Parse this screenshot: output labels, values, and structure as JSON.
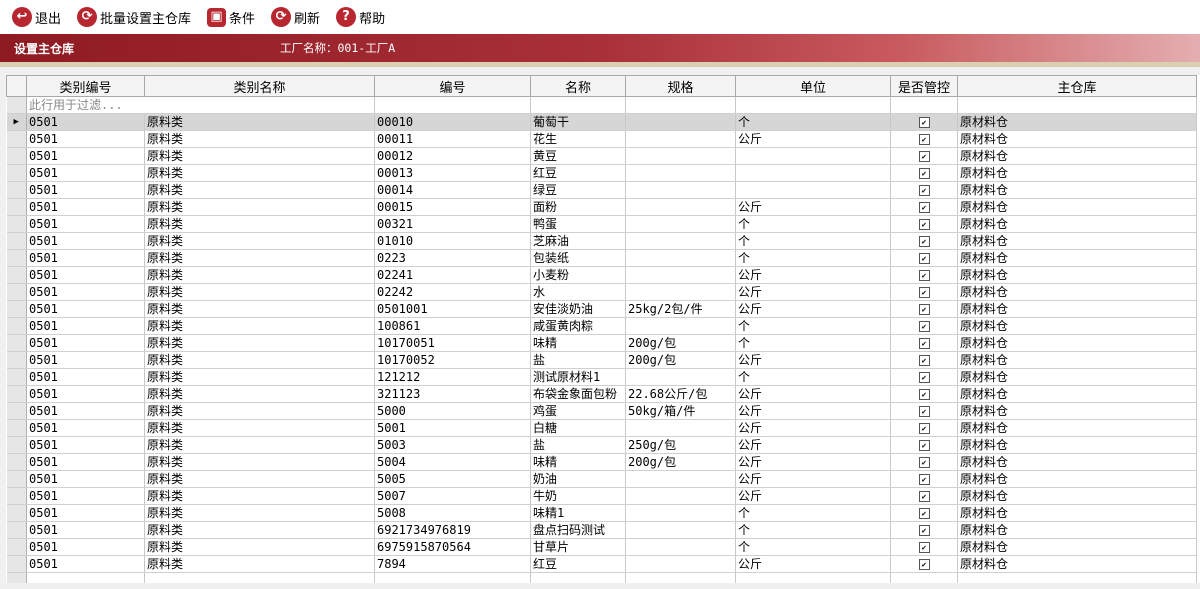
{
  "toolbar": {
    "buttons": [
      {
        "id": "exit",
        "label": "退出",
        "icon": "exit-icon",
        "glyph": "↩"
      },
      {
        "id": "batch",
        "label": "批量设置主仓库",
        "icon": "refresh-icon",
        "glyph": "⟳"
      },
      {
        "id": "condition",
        "label": "条件",
        "icon": "condition-icon",
        "glyph": "▣"
      },
      {
        "id": "refresh",
        "label": "刷新",
        "icon": "refresh-icon",
        "glyph": "⟳"
      },
      {
        "id": "help",
        "label": "帮助",
        "icon": "help-icon",
        "glyph": "?"
      }
    ]
  },
  "titlebar": {
    "title": "设置主仓库",
    "factory": "工厂名称：001-工厂A"
  },
  "colors": {
    "accent": "#b8272f",
    "titlebar": "#8e1a22"
  },
  "table": {
    "columns": [
      "类别编号",
      "类别名称",
      "编号",
      "名称",
      "规格",
      "单位",
      "是否管控",
      "主仓库"
    ],
    "filter_placeholder": "此行用于过滤...",
    "rows": [
      {
        "cat_code": "0501",
        "cat_name": "原料类",
        "code": "00010",
        "name": "葡萄干",
        "spec": "",
        "unit": "个",
        "controlled": true,
        "warehouse": "原材料仓"
      },
      {
        "cat_code": "0501",
        "cat_name": "原料类",
        "code": "00011",
        "name": "花生",
        "spec": "",
        "unit": "公斤",
        "controlled": true,
        "warehouse": "原材料仓"
      },
      {
        "cat_code": "0501",
        "cat_name": "原料类",
        "code": "00012",
        "name": "黄豆",
        "spec": "",
        "unit": "",
        "controlled": true,
        "warehouse": "原材料仓"
      },
      {
        "cat_code": "0501",
        "cat_name": "原料类",
        "code": "00013",
        "name": "红豆",
        "spec": "",
        "unit": "",
        "controlled": true,
        "warehouse": "原材料仓"
      },
      {
        "cat_code": "0501",
        "cat_name": "原料类",
        "code": "00014",
        "name": "绿豆",
        "spec": "",
        "unit": "",
        "controlled": true,
        "warehouse": "原材料仓"
      },
      {
        "cat_code": "0501",
        "cat_name": "原料类",
        "code": "00015",
        "name": "面粉",
        "spec": "",
        "unit": "公斤",
        "controlled": true,
        "warehouse": "原材料仓"
      },
      {
        "cat_code": "0501",
        "cat_name": "原料类",
        "code": "00321",
        "name": "鸭蛋",
        "spec": "",
        "unit": "个",
        "controlled": true,
        "warehouse": "原材料仓"
      },
      {
        "cat_code": "0501",
        "cat_name": "原料类",
        "code": "01010",
        "name": "芝麻油",
        "spec": "",
        "unit": "个",
        "controlled": true,
        "warehouse": "原材料仓"
      },
      {
        "cat_code": "0501",
        "cat_name": "原料类",
        "code": "0223",
        "name": "包装纸",
        "spec": "",
        "unit": "个",
        "controlled": true,
        "warehouse": "原材料仓"
      },
      {
        "cat_code": "0501",
        "cat_name": "原料类",
        "code": "02241",
        "name": "小麦粉",
        "spec": "",
        "unit": "公斤",
        "controlled": true,
        "warehouse": "原材料仓"
      },
      {
        "cat_code": "0501",
        "cat_name": "原料类",
        "code": "02242",
        "name": "水",
        "spec": "",
        "unit": "公斤",
        "controlled": true,
        "warehouse": "原材料仓"
      },
      {
        "cat_code": "0501",
        "cat_name": "原料类",
        "code": "0501001",
        "name": "安佳淡奶油",
        "spec": "25kg/2包/件",
        "unit": "公斤",
        "controlled": true,
        "warehouse": "原材料仓"
      },
      {
        "cat_code": "0501",
        "cat_name": "原料类",
        "code": "100861",
        "name": "咸蛋黄肉粽",
        "spec": "",
        "unit": "个",
        "controlled": true,
        "warehouse": "原材料仓"
      },
      {
        "cat_code": "0501",
        "cat_name": "原料类",
        "code": "10170051",
        "name": "味精",
        "spec": "200g/包",
        "unit": "个",
        "controlled": true,
        "warehouse": "原材料仓"
      },
      {
        "cat_code": "0501",
        "cat_name": "原料类",
        "code": "10170052",
        "name": "盐",
        "spec": "200g/包",
        "unit": "公斤",
        "controlled": true,
        "warehouse": "原材料仓"
      },
      {
        "cat_code": "0501",
        "cat_name": "原料类",
        "code": "121212",
        "name": "测试原材料1",
        "spec": "",
        "unit": "个",
        "controlled": true,
        "warehouse": "原材料仓"
      },
      {
        "cat_code": "0501",
        "cat_name": "原料类",
        "code": "321123",
        "name": "布袋金象面包粉",
        "spec": "22.68公斤/包",
        "unit": "公斤",
        "controlled": true,
        "warehouse": "原材料仓"
      },
      {
        "cat_code": "0501",
        "cat_name": "原料类",
        "code": "5000",
        "name": "鸡蛋",
        "spec": "50kg/箱/件",
        "unit": "公斤",
        "controlled": true,
        "warehouse": "原材料仓"
      },
      {
        "cat_code": "0501",
        "cat_name": "原料类",
        "code": "5001",
        "name": "白糖",
        "spec": "",
        "unit": "公斤",
        "controlled": true,
        "warehouse": "原材料仓"
      },
      {
        "cat_code": "0501",
        "cat_name": "原料类",
        "code": "5003",
        "name": "盐",
        "spec": "250g/包",
        "unit": "公斤",
        "controlled": true,
        "warehouse": "原材料仓"
      },
      {
        "cat_code": "0501",
        "cat_name": "原料类",
        "code": "5004",
        "name": "味精",
        "spec": "200g/包",
        "unit": "公斤",
        "controlled": true,
        "warehouse": "原材料仓"
      },
      {
        "cat_code": "0501",
        "cat_name": "原料类",
        "code": "5005",
        "name": "奶油",
        "spec": "",
        "unit": "公斤",
        "controlled": true,
        "warehouse": "原材料仓"
      },
      {
        "cat_code": "0501",
        "cat_name": "原料类",
        "code": "5007",
        "name": "牛奶",
        "spec": "",
        "unit": "公斤",
        "controlled": true,
        "warehouse": "原材料仓"
      },
      {
        "cat_code": "0501",
        "cat_name": "原料类",
        "code": "5008",
        "name": "味精1",
        "spec": "",
        "unit": "个",
        "controlled": true,
        "warehouse": "原材料仓"
      },
      {
        "cat_code": "0501",
        "cat_name": "原料类",
        "code": "6921734976819",
        "name": "盘点扫码测试",
        "spec": "",
        "unit": "个",
        "controlled": true,
        "warehouse": "原材料仓"
      },
      {
        "cat_code": "0501",
        "cat_name": "原料类",
        "code": "6975915870564",
        "name": "甘草片",
        "spec": "",
        "unit": "个",
        "controlled": true,
        "warehouse": "原材料仓"
      },
      {
        "cat_code": "0501",
        "cat_name": "原料类",
        "code": "7894",
        "name": "红豆",
        "spec": "",
        "unit": "公斤",
        "controlled": true,
        "warehouse": "原材料仓"
      }
    ]
  }
}
